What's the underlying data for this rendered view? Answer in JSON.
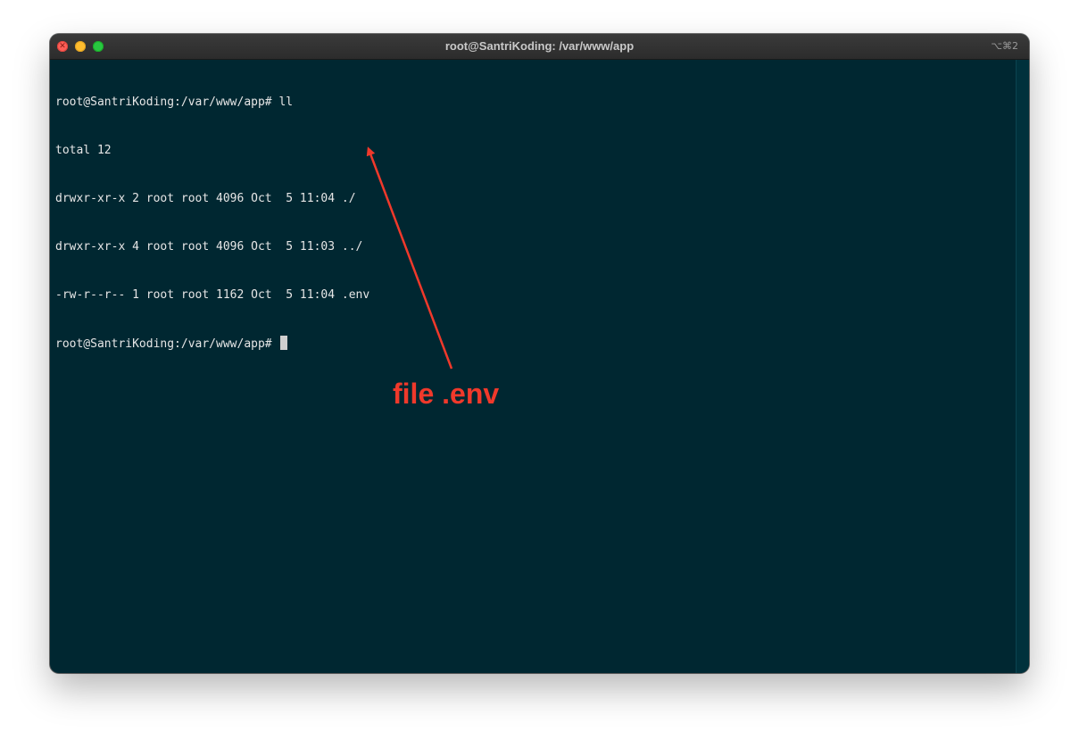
{
  "window": {
    "title": "root@SantriKoding: /var/www/app",
    "shortcut": "⌥⌘2"
  },
  "terminal": {
    "lines": [
      "root@SantriKoding:/var/www/app# ll",
      "total 12",
      "drwxr-xr-x 2 root root 4096 Oct  5 11:04 ./",
      "drwxr-xr-x 4 root root 4096 Oct  5 11:03 ../",
      "-rw-r--r-- 1 root root 1162 Oct  5 11:04 .env"
    ],
    "prompt": "root@SantriKoding:/var/www/app# "
  },
  "annotation": {
    "label": "file .env",
    "color": "#f0392b"
  },
  "colors": {
    "terminal_bg": "#002731",
    "terminal_fg": "#e6e6e6",
    "titlebar_bg": "#2c2c2c"
  },
  "icons": {
    "close": "close-icon",
    "minimize": "minimize-icon",
    "zoom": "zoom-icon",
    "arrow": "arrow-icon"
  }
}
